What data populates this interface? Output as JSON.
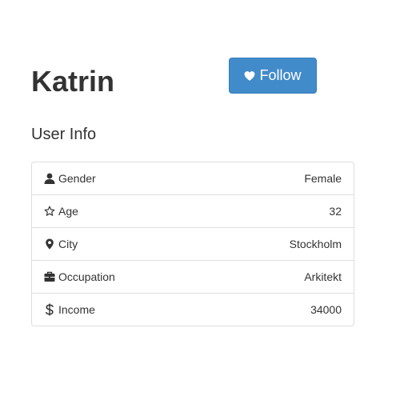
{
  "profile": {
    "name": "Katrin",
    "follow_label": "Follow"
  },
  "info": {
    "title": "User Info",
    "rows": [
      {
        "icon": "user-icon",
        "label": "Gender",
        "value": "Female"
      },
      {
        "icon": "star-outline-icon",
        "label": "Age",
        "value": "32"
      },
      {
        "icon": "map-marker-icon",
        "label": "City",
        "value": "Stockholm"
      },
      {
        "icon": "briefcase-icon",
        "label": "Occupation",
        "value": "Arkitekt"
      },
      {
        "icon": "dollar-icon",
        "label": "Income",
        "value": "34000"
      }
    ]
  },
  "colors": {
    "button_bg": "#428bca",
    "text": "#333333",
    "border": "#dddddd"
  }
}
